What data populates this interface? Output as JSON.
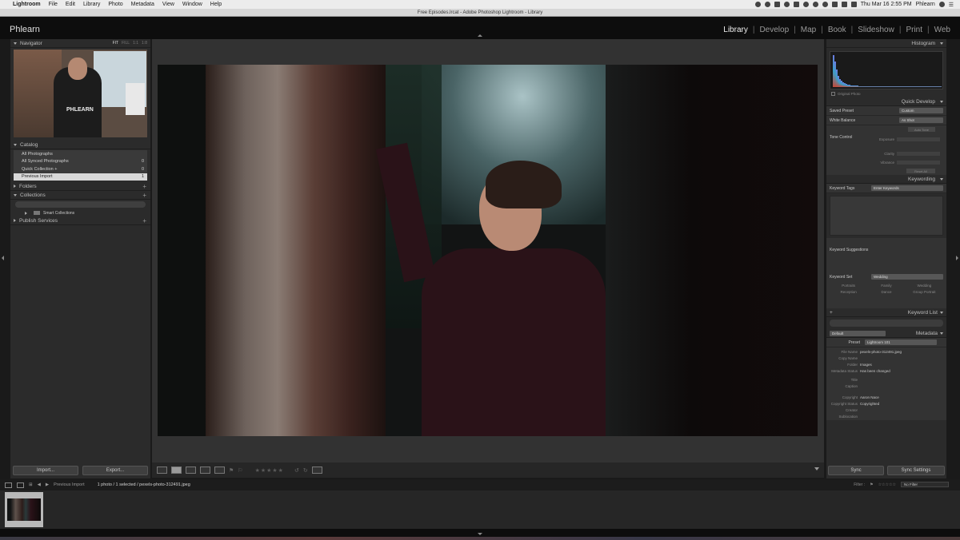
{
  "menubar": {
    "app": "Lightroom",
    "menus": [
      "File",
      "Edit",
      "Library",
      "Photo",
      "Metadata",
      "View",
      "Window",
      "Help"
    ],
    "clock": "Thu Mar 16  2:55 PM",
    "user": "Phlearn"
  },
  "window": {
    "title": "Free Episodes.lrcat - Adobe Photoshop Lightroom - Library"
  },
  "identity_plate": "Phlearn",
  "modules": [
    "Library",
    "Develop",
    "Map",
    "Book",
    "Slideshow",
    "Print",
    "Web"
  ],
  "active_module": "Library",
  "left_panel": {
    "navigator": {
      "title": "Navigator",
      "zoom": [
        "FIT",
        "FILL",
        "1:1",
        "1:8"
      ],
      "image_text": "PHLEARN"
    },
    "catalog": {
      "title": "Catalog",
      "items": [
        {
          "label": "All Photographs",
          "count": ""
        },
        {
          "label": "All Synced Photographs",
          "count": "0"
        },
        {
          "label": "Quick Collection +",
          "count": "0"
        },
        {
          "label": "Previous Import",
          "count": "1"
        }
      ]
    },
    "folders": {
      "title": "Folders"
    },
    "collections": {
      "title": "Collections",
      "smart": "Smart Collections"
    },
    "publish": {
      "title": "Publish Services"
    },
    "import_button": "Import...",
    "export_button": "Export..."
  },
  "right_panel": {
    "histogram": {
      "title": "Histogram",
      "original_photo": "Original Photo",
      "bins": [
        40,
        32,
        22,
        14,
        10,
        8,
        6,
        5,
        4,
        3,
        3,
        2,
        2,
        2,
        2,
        2,
        1,
        1,
        1,
        1,
        1,
        1,
        1,
        1,
        1,
        1,
        1,
        1,
        1,
        1,
        1,
        1,
        1,
        1,
        1,
        1,
        1,
        1,
        1,
        1,
        1,
        1,
        1,
        1,
        1,
        1,
        1,
        1,
        1,
        1,
        1,
        1,
        1,
        1,
        1,
        1,
        1,
        1,
        1,
        1,
        1,
        1,
        1,
        1,
        1,
        1,
        1,
        1
      ]
    },
    "quick_develop": {
      "title": "Quick Develop",
      "saved_preset_label": "Saved Preset",
      "saved_preset_value": "Custom",
      "white_balance_label": "White Balance",
      "white_balance_value": "As Shot",
      "tone_control_label": "Tone Control",
      "auto_tone": "Auto Tone",
      "exposure": "Exposure",
      "clarity": "Clarity",
      "vibrance": "Vibrance",
      "reset_all": "Reset All"
    },
    "keywording": {
      "title": "Keywording",
      "tags_label": "Keyword Tags",
      "tags_value": "Enter Keywords",
      "suggestions_label": "Keyword Suggestions",
      "set_label": "Keyword Set",
      "set_value": "Wedding",
      "set_items": [
        "Portraits",
        "Family",
        "Wedding",
        "Reception",
        "Dance",
        "Group Portrait"
      ]
    },
    "keyword_list": {
      "title": "Keyword List"
    },
    "metadata": {
      "title": "Metadata",
      "view": "Default",
      "preset_label": "Preset",
      "preset_value": "Lightroom 101",
      "rows": [
        {
          "k": "File Name",
          "v": "pexels-photo-312491.jpeg"
        },
        {
          "k": "Copy Name",
          "v": ""
        },
        {
          "k": "Folder",
          "v": "Images"
        },
        {
          "k": "Metadata Status",
          "v": "Has been changed"
        },
        {
          "k": "Title",
          "v": ""
        },
        {
          "k": "Caption",
          "v": ""
        },
        {
          "k": "Copyright",
          "v": "Aaron Nace"
        },
        {
          "k": "Copyright Status",
          "v": "Copyrighted"
        },
        {
          "k": "Creator",
          "v": ""
        },
        {
          "k": "Sublocation",
          "v": ""
        }
      ]
    },
    "sync_button": "Sync",
    "sync_settings_button": "Sync Settings"
  },
  "toolbar": {
    "stars": "★★★★★"
  },
  "filmstrip": {
    "source": "Previous Import",
    "selection": "1 photo / 1 selected / pexels-photo-312491.jpeg",
    "filter_label": "Filter :",
    "filter_value": "No Filter"
  }
}
